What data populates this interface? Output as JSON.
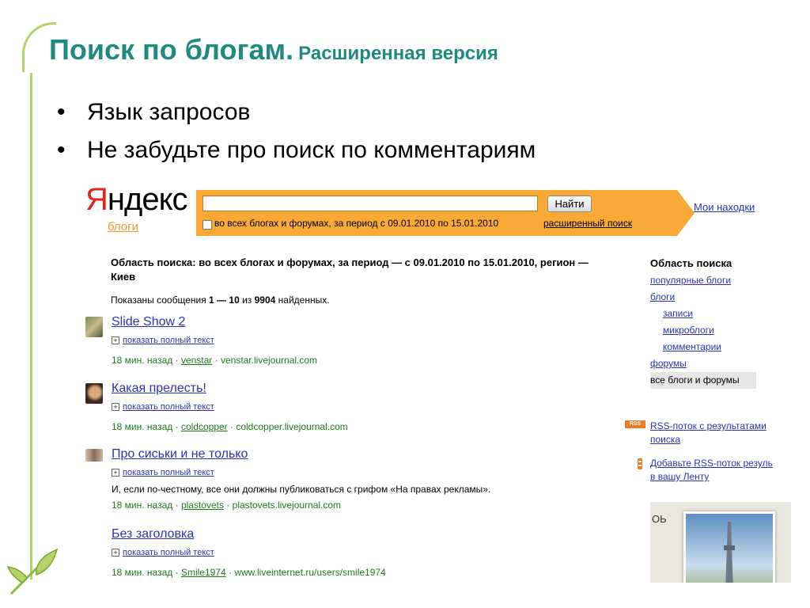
{
  "slide": {
    "title_main": "Поиск по блогам.",
    "title_sub": "Расширенная версия",
    "bullets": [
      "Язык запросов",
      "Не забудьте про поиск по комментариям"
    ],
    "bullet_glyph": "•"
  },
  "yandex": {
    "logo_first": "Я",
    "logo_rest": "ндекс",
    "logo_sub": "блоги",
    "search_value": "",
    "search_button": "Найти",
    "scope_text": "во всех блогах и форумах, за период с 09.01.2010 по 15.01.2010",
    "advanced_link": "расширенный поиск",
    "my_finds": "Мои находки"
  },
  "results_header": {
    "area": "Область поиска: во всех блогах и форумах, за период — с 09.01.2010 по 15.01.2010, регион — Киев",
    "shown_prefix": "Показаны сообщения ",
    "shown_range": "1 — 10",
    "shown_mid": " из ",
    "shown_total": "9904",
    "shown_suffix": " найденных."
  },
  "results": [
    {
      "title": "Slide Show 2",
      "expand": "показать полный текст",
      "snippet": "",
      "time": "18 мин. назад",
      "user": "venstar",
      "site": "venstar.livejournal.com"
    },
    {
      "title": "Какая прелесть!",
      "expand": "показать полный текст",
      "snippet": "",
      "time": "18 мин. назад",
      "user": "coldcopper",
      "site": "coldcopper.livejournal.com"
    },
    {
      "title": "Про сиськи и не только",
      "expand": "показать полный текст",
      "snippet": "И, если по-честному, все они должны публиковаться с грифом «На правах рекламы».",
      "time": "18 мин. назад",
      "user": "plastovets",
      "site": "plastovets.livejournal.com"
    },
    {
      "title": "Без заголовка",
      "expand": "показать полный текст",
      "snippet": "",
      "time": "18 мин. назад",
      "user": "Smile1974",
      "site": "www.liveinternet.ru/users/smile1974"
    }
  ],
  "meta_sep": " · ",
  "expand_glyph": "+",
  "sidebar": {
    "title": "Область поиска",
    "popular": "популярные блоги",
    "blogs": "блоги",
    "posts": "записи",
    "microblogs": "микроблоги",
    "comments": "комментарии",
    "forums": "форумы",
    "all": "все блоги и форумы"
  },
  "rss": {
    "badge": "RSS",
    "feed_link": "RSS-поток с результатами поиска",
    "add_link_line1": "Добавьте RSS-поток резуль",
    "add_link_line2": "в вашу Ленту"
  },
  "map": {
    "label": "ОЬ"
  },
  "colors": {
    "title": "#1f8a80",
    "accent": "#b5d36a",
    "search_bar": "#f8a936",
    "link": "#2a32b8",
    "meta_green": "#1d7a1d",
    "logo_red": "#e2231a"
  }
}
